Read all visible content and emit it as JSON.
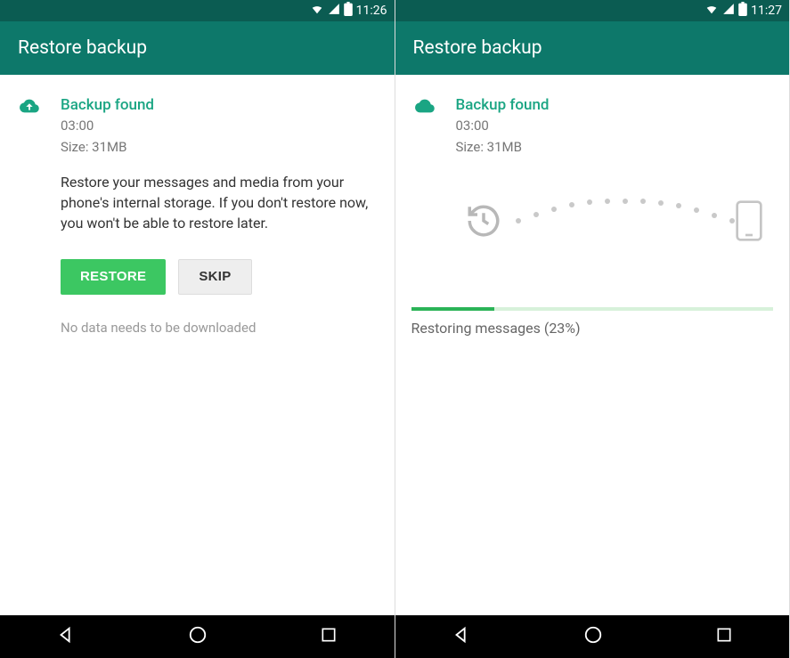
{
  "left": {
    "status": {
      "time": "11:26"
    },
    "header": {
      "title": "Restore backup"
    },
    "backup": {
      "title": "Backup found",
      "time": "03:00",
      "size": "Size: 31MB"
    },
    "description": "Restore your messages and media from your phone's internal storage. If you don't restore now, you won't be able to restore later.",
    "buttons": {
      "restore": "RESTORE",
      "skip": "SKIP"
    },
    "noData": "No data needs to be downloaded"
  },
  "right": {
    "status": {
      "time": "11:27"
    },
    "header": {
      "title": "Restore backup"
    },
    "backup": {
      "title": "Backup found",
      "time": "03:00",
      "size": "Size: 31MB"
    },
    "progress": {
      "percent": 23,
      "text": "Restoring messages (23%)"
    }
  }
}
